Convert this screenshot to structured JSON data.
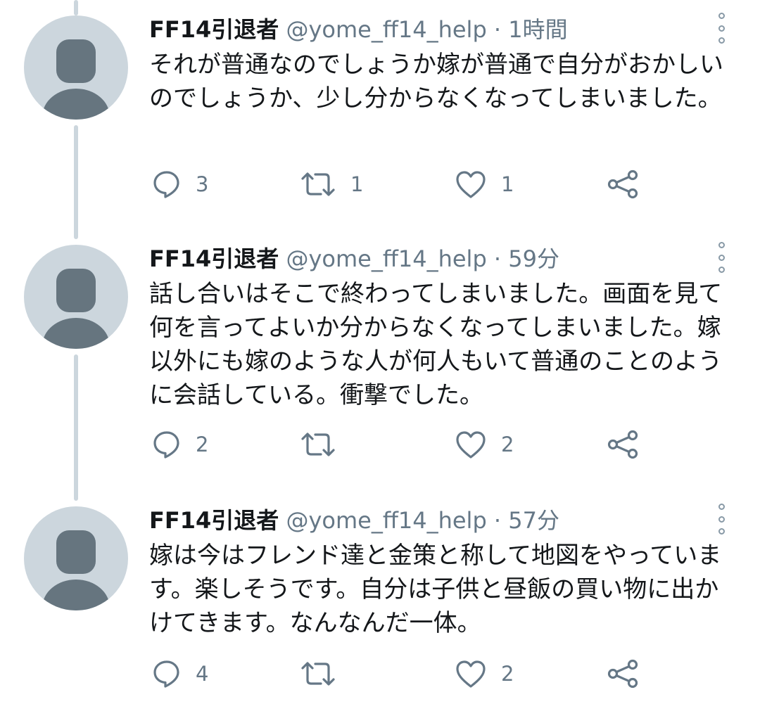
{
  "tweets": [
    {
      "name": "FF14引退者",
      "handle": "@yome_ff14_help",
      "time": "· 1時間",
      "text": "それが普通なのでしょうか嫁が普通で自分がおかしいのでしょうか、少し分からなくなってしまいました。",
      "replies": "3",
      "retweets": "1",
      "likes": "1"
    },
    {
      "name": "FF14引退者",
      "handle": "@yome_ff14_help",
      "time": "· 59分",
      "text": "話し合いはそこで終わってしまいました。画面を見て何を言ってよいか分からなくなってしまいました。嫁以外にも嫁のような人が何人もいて普通のことのように会話している。衝撃でした。",
      "replies": "2",
      "retweets": "",
      "likes": "2"
    },
    {
      "name": "FF14引退者",
      "handle": "@yome_ff14_help",
      "time": "· 57分",
      "text": "嫁は今はフレンド達と金策と称して地図をやっています。楽しそうです。自分は子供と昼飯の買い物に出かけてきます。なんなんだ一体。",
      "replies": "4",
      "retweets": "",
      "likes": "2"
    }
  ],
  "icons": {
    "reply": "reply-icon",
    "retweet": "retweet-icon",
    "like": "heart-icon",
    "share": "share-icon",
    "more": "more-vertical-icon"
  },
  "colors": {
    "text": "#14171a",
    "secondary": "#657786",
    "icon": "#657786",
    "thread_line": "#ccd6dd",
    "avatar_bg": "#ccd6dd",
    "avatar_fg": "#66757f"
  }
}
